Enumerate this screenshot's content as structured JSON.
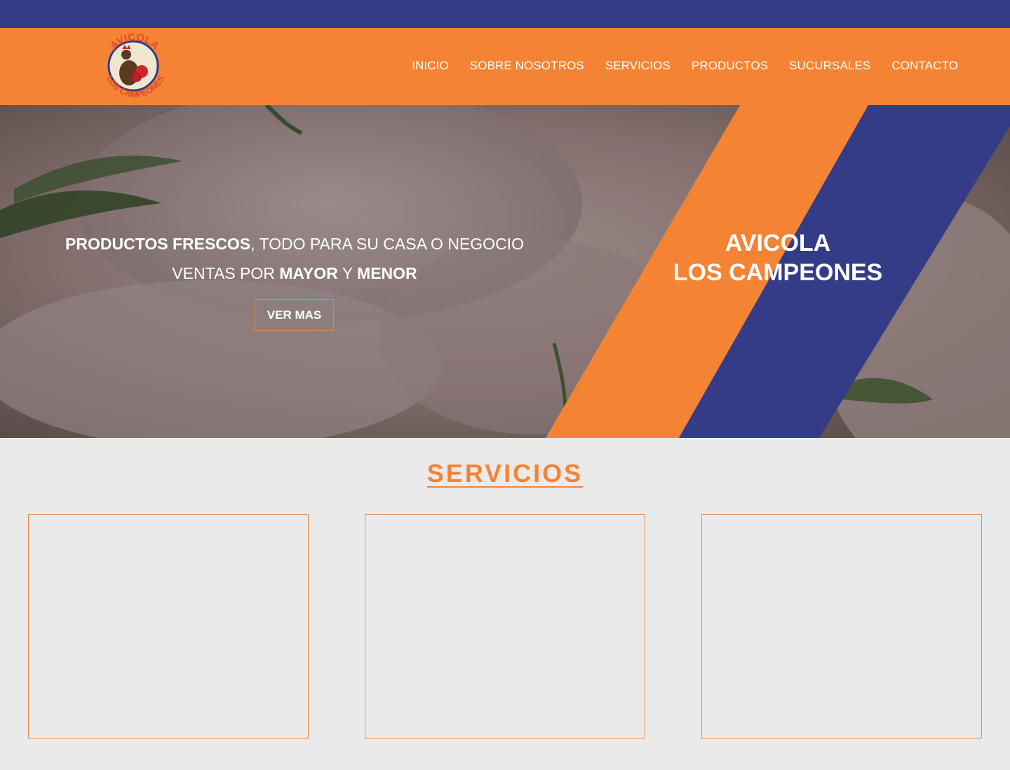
{
  "colors": {
    "navy": "#343b87",
    "orange": "#f48434",
    "background": "#ebeaea"
  },
  "logo": {
    "top_text": "AVICOLA",
    "bottom_text": "LOS CAMPEONES"
  },
  "nav": {
    "items": [
      {
        "label": "INICIO"
      },
      {
        "label": "SOBRE NOSOTROS"
      },
      {
        "label": "SERVICIOS"
      },
      {
        "label": "PRODUCTOS"
      },
      {
        "label": "SUCURSALES"
      },
      {
        "label": "CONTACTO"
      }
    ]
  },
  "hero": {
    "line1_bold": "PRODUCTOS FRESCOS",
    "line1_rest": ", TODO PARA SU  CASA O NEGOCIO",
    "line2_pre": "VENTAS POR ",
    "line2_bold1": "MAYOR",
    "line2_mid": " Y ",
    "line2_bold2": "MENOR",
    "button_label": "VER MAS",
    "brand_line1": "AVICOLA",
    "brand_line2": "LOS CAMPEONES"
  },
  "services": {
    "title": "SERVICIOS",
    "cards": [
      "",
      "",
      ""
    ]
  }
}
